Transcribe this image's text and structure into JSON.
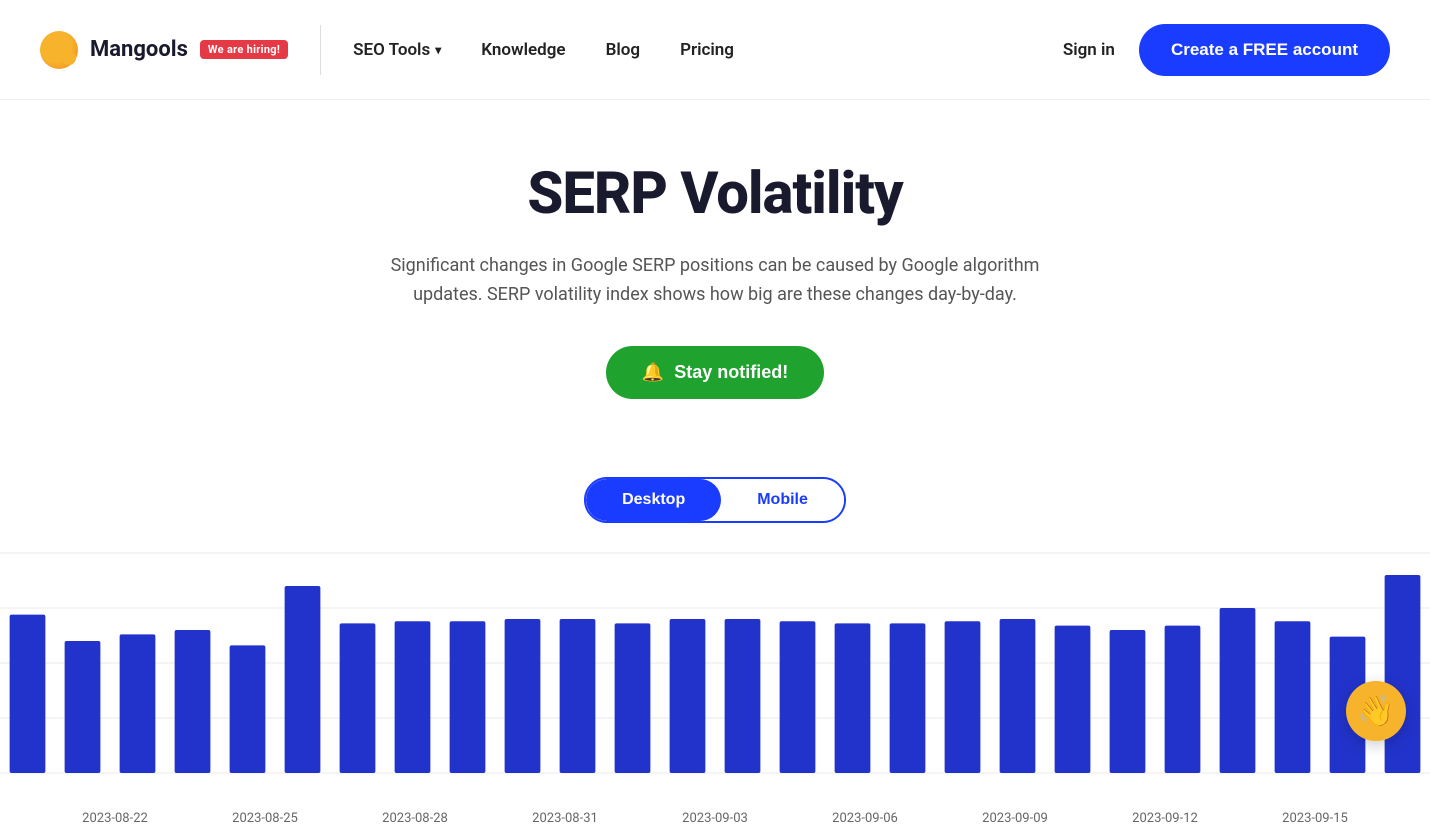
{
  "nav": {
    "logo_text": "Mangools",
    "hiring_badge": "We are hiring!",
    "seo_tools_label": "SEO Tools",
    "knowledge_label": "Knowledge",
    "blog_label": "Blog",
    "pricing_label": "Pricing",
    "sign_in_label": "Sign in",
    "cta_label": "Create a FREE account"
  },
  "hero": {
    "title": "SERP Volatility",
    "subtitle": "Significant changes in Google SERP positions can be caused by Google algorithm updates. SERP volatility index shows how big are these changes day-by-day.",
    "notify_button": "Stay notified!"
  },
  "tabs": {
    "desktop_label": "Desktop",
    "mobile_label": "Mobile"
  },
  "chart": {
    "bar_color": "#2233cc",
    "grid_color": "#e8e8e8",
    "bars": [
      {
        "date": "2023-08-22",
        "value": 72
      },
      {
        "date": "",
        "value": 60
      },
      {
        "date": "",
        "value": 63
      },
      {
        "date": "",
        "value": 65
      },
      {
        "date": "2023-08-25",
        "value": 58
      },
      {
        "date": "",
        "value": 85
      },
      {
        "date": "",
        "value": 68
      },
      {
        "date": "2023-08-28",
        "value": 69
      },
      {
        "date": "",
        "value": 69
      },
      {
        "date": "",
        "value": 70
      },
      {
        "date": "2023-08-31",
        "value": 70
      },
      {
        "date": "",
        "value": 68
      },
      {
        "date": "",
        "value": 70
      },
      {
        "date": "2023-09-03",
        "value": 70
      },
      {
        "date": "",
        "value": 69
      },
      {
        "date": "",
        "value": 68
      },
      {
        "date": "2023-09-06",
        "value": 68
      },
      {
        "date": "",
        "value": 69
      },
      {
        "date": "",
        "value": 70
      },
      {
        "date": "2023-09-09",
        "value": 67
      },
      {
        "date": "",
        "value": 65
      },
      {
        "date": "",
        "value": 67
      },
      {
        "date": "2023-09-12",
        "value": 75
      },
      {
        "date": "",
        "value": 69
      },
      {
        "date": "",
        "value": 62
      },
      {
        "date": "2023-09-15",
        "value": 90
      }
    ],
    "x_labels": [
      "2023-08-22",
      "2023-08-25",
      "2023-08-28",
      "2023-08-31",
      "2023-09-03",
      "2023-09-06",
      "2023-09-09",
      "2023-09-12",
      "2023-09-15"
    ]
  },
  "chatbot": {
    "icon": "👋"
  }
}
